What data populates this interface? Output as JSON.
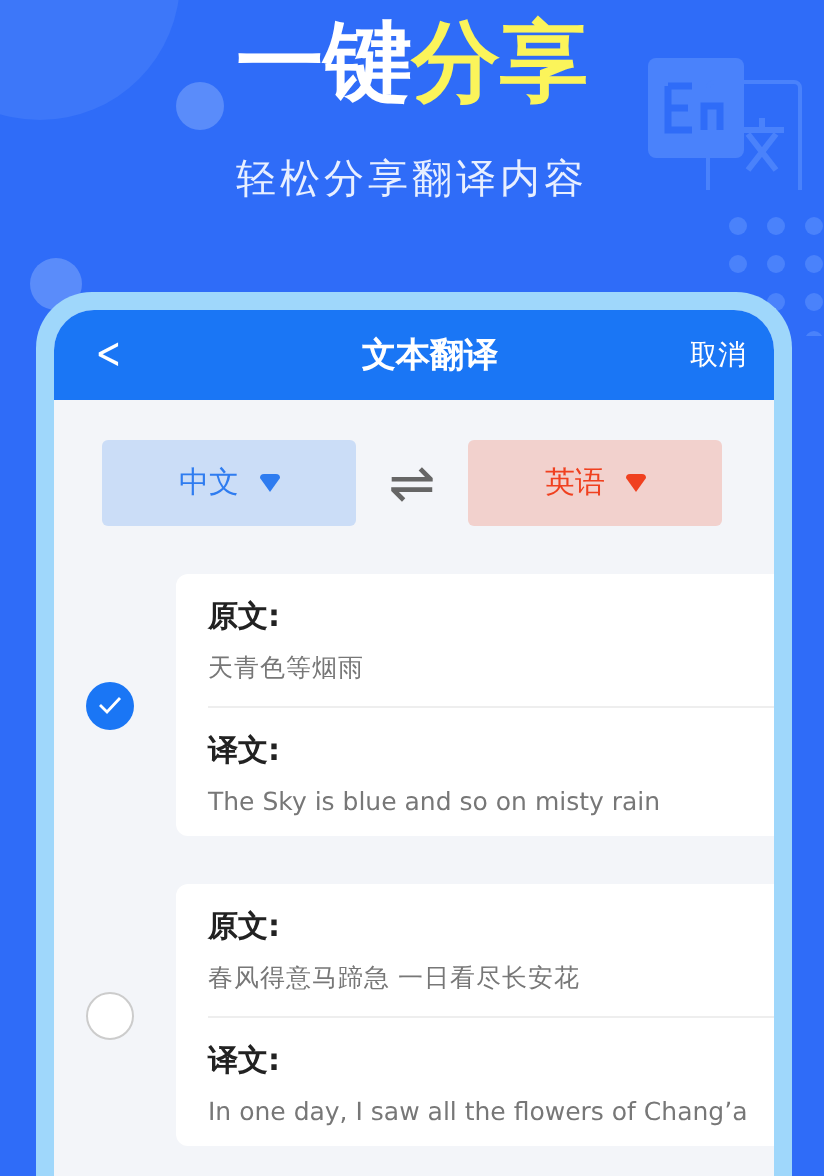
{
  "headline": [
    {
      "text": "一键",
      "highlight": false
    },
    {
      "text": "分享",
      "highlight": true
    }
  ],
  "subtitle": "轻松分享翻译内容",
  "screen": {
    "nav": {
      "back": "<",
      "title": "文本翻译",
      "action": "取消"
    },
    "languages": [
      {
        "label": "中文",
        "color": "#2f7cf0"
      },
      {
        "label": "英语",
        "color": "#f0401f"
      }
    ],
    "swap": "⇌",
    "items": [
      {
        "selected": true,
        "source_label": "原文:",
        "source": "天青色等烟雨",
        "target_label": "译文:",
        "target": "The Sky is blue and so on misty rain"
      },
      {
        "selected": false,
        "source_label": "原文:",
        "source": "春风得意马蹄急 一日看尽长安花",
        "target_label": "译文:",
        "target": "In one day, I saw all the flowers of Chang’a"
      }
    ]
  }
}
